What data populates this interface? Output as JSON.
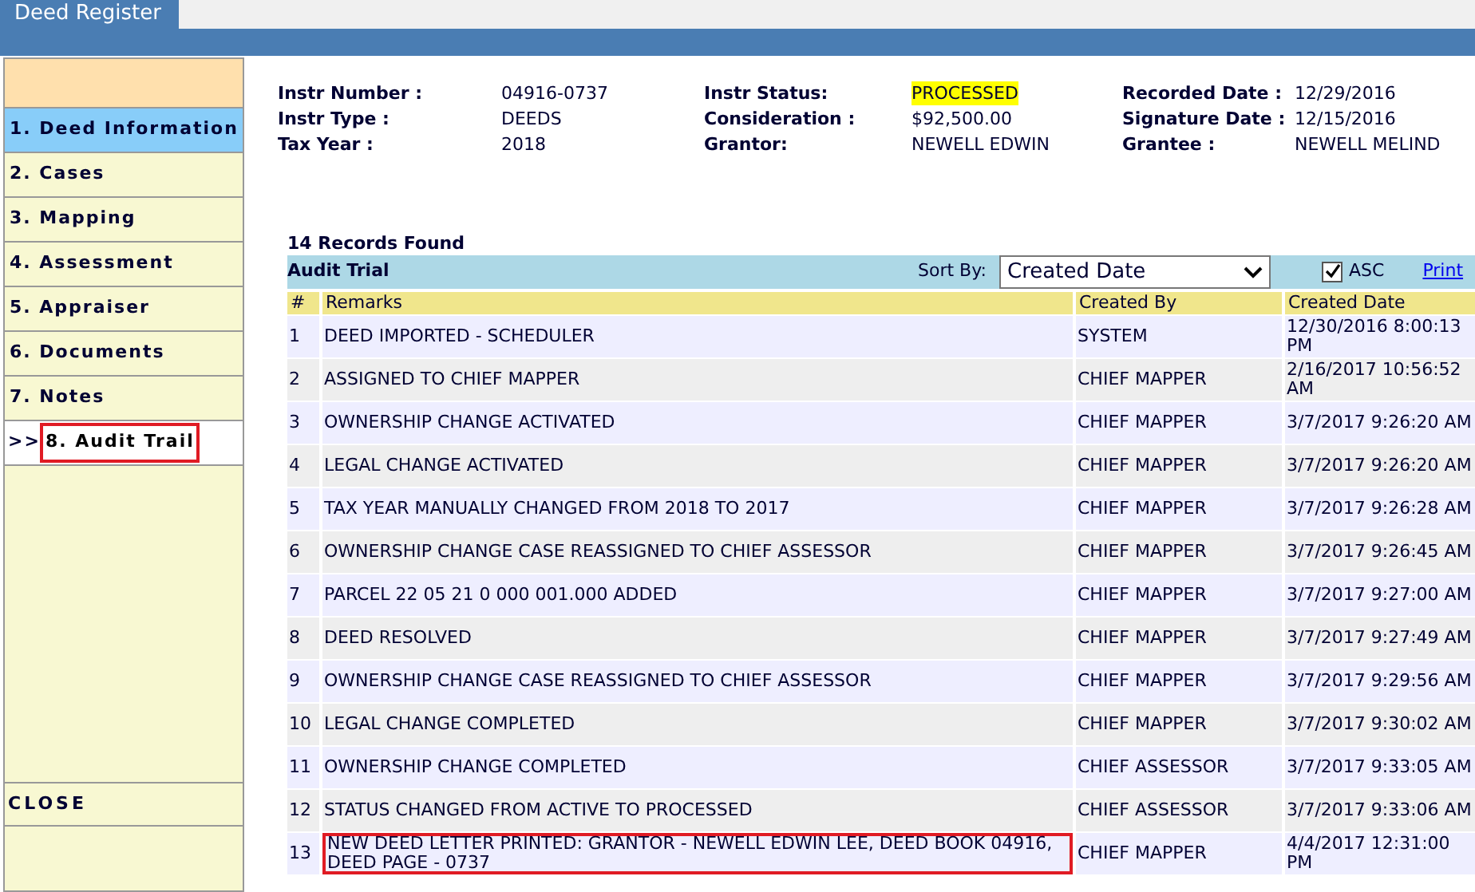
{
  "tab": {
    "label": "Deed Register"
  },
  "sidebar": {
    "items": [
      {
        "label": "1. Deed Information",
        "selected": false,
        "current": false,
        "highlighted": false
      },
      {
        "label": "2. Cases",
        "selected": false,
        "current": false,
        "highlighted": false
      },
      {
        "label": "3. Mapping",
        "selected": false,
        "current": false,
        "highlighted": false
      },
      {
        "label": "4. Assessment",
        "selected": false,
        "current": false,
        "highlighted": false
      },
      {
        "label": "5. Appraiser",
        "selected": false,
        "current": false,
        "highlighted": false
      },
      {
        "label": "6. Documents",
        "selected": false,
        "current": false,
        "highlighted": false
      },
      {
        "label": "7. Notes",
        "selected": false,
        "current": false,
        "highlighted": false
      },
      {
        "label": "8. Audit Trail",
        "selected": true,
        "current": true,
        "highlighted": true
      }
    ],
    "first_item_hover": true,
    "current_marker": ">>",
    "close": "CLOSE"
  },
  "info": [
    [
      {
        "label": "Instr Number :",
        "value": "04916-0737",
        "flag": false
      },
      {
        "label": "Instr Status:",
        "value": "PROCESSED",
        "flag": true
      },
      {
        "label": "Recorded Date :",
        "value": "12/29/2016",
        "flag": false
      }
    ],
    [
      {
        "label": "Instr Type :",
        "value": "DEEDS",
        "flag": false
      },
      {
        "label": "Consideration :",
        "value": "$92,500.00",
        "flag": false
      },
      {
        "label": "Signature Date :",
        "value": "12/15/2016",
        "flag": false
      }
    ],
    [
      {
        "label": "Tax Year :",
        "value": "2018",
        "flag": false
      },
      {
        "label": "Grantor:",
        "value": "NEWELL EDWIN",
        "flag": false
      },
      {
        "label": "Grantee :",
        "value": "NEWELL MELIND",
        "flag": false
      }
    ]
  ],
  "records_found": "14 Records Found",
  "audit": {
    "title": "Audit Trial",
    "sort_label": "Sort By:",
    "sort_value": "Created Date",
    "asc": {
      "label": "ASC",
      "checked": true
    },
    "print": "Print"
  },
  "table": {
    "columns": [
      "#",
      "Remarks",
      "Created By",
      "Created Date"
    ],
    "rows": [
      {
        "cells": [
          "1",
          "DEED IMPORTED - SCHEDULER",
          "SYSTEM",
          "12/30/2016 8:00:13 PM"
        ],
        "highlighted": false
      },
      {
        "cells": [
          "2",
          "ASSIGNED TO CHIEF MAPPER",
          "CHIEF MAPPER",
          "2/16/2017 10:56:52 AM"
        ],
        "highlighted": false
      },
      {
        "cells": [
          "3",
          "OWNERSHIP CHANGE ACTIVATED",
          "CHIEF MAPPER",
          "3/7/2017 9:26:20 AM"
        ],
        "highlighted": false
      },
      {
        "cells": [
          "4",
          "LEGAL CHANGE ACTIVATED",
          "CHIEF MAPPER",
          "3/7/2017 9:26:20 AM"
        ],
        "highlighted": false
      },
      {
        "cells": [
          "5",
          "TAX YEAR MANUALLY CHANGED FROM 2018 TO 2017",
          "CHIEF MAPPER",
          "3/7/2017 9:26:28 AM"
        ],
        "highlighted": false
      },
      {
        "cells": [
          "6",
          "OWNERSHIP CHANGE CASE REASSIGNED TO CHIEF ASSESSOR",
          "CHIEF MAPPER",
          "3/7/2017 9:26:45 AM"
        ],
        "highlighted": false
      },
      {
        "cells": [
          "7",
          "PARCEL 22 05 21 0 000 001.000 ADDED",
          "CHIEF MAPPER",
          "3/7/2017 9:27:00 AM"
        ],
        "highlighted": false
      },
      {
        "cells": [
          "8",
          "DEED RESOLVED",
          "CHIEF MAPPER",
          "3/7/2017 9:27:49 AM"
        ],
        "highlighted": false
      },
      {
        "cells": [
          "9",
          "OWNERSHIP CHANGE CASE REASSIGNED TO CHIEF ASSESSOR",
          "CHIEF MAPPER",
          "3/7/2017 9:29:56 AM"
        ],
        "highlighted": false
      },
      {
        "cells": [
          "10",
          "LEGAL CHANGE COMPLETED",
          "CHIEF MAPPER",
          "3/7/2017 9:30:02 AM"
        ],
        "highlighted": false
      },
      {
        "cells": [
          "11",
          "OWNERSHIP CHANGE COMPLETED",
          "CHIEF ASSESSOR",
          "3/7/2017 9:33:05 AM"
        ],
        "highlighted": false
      },
      {
        "cells": [
          "12",
          "STATUS CHANGED FROM ACTIVE TO PROCESSED",
          "CHIEF ASSESSOR",
          "3/7/2017 9:33:06 AM"
        ],
        "highlighted": false
      },
      {
        "cells": [
          "13",
          "NEW DEED LETTER PRINTED: GRANTOR - NEWELL EDWIN LEE, DEED BOOK 04916, DEED PAGE - 0737",
          "CHIEF MAPPER",
          "4/4/2017 12:31:00 PM"
        ],
        "highlighted": true
      }
    ]
  }
}
